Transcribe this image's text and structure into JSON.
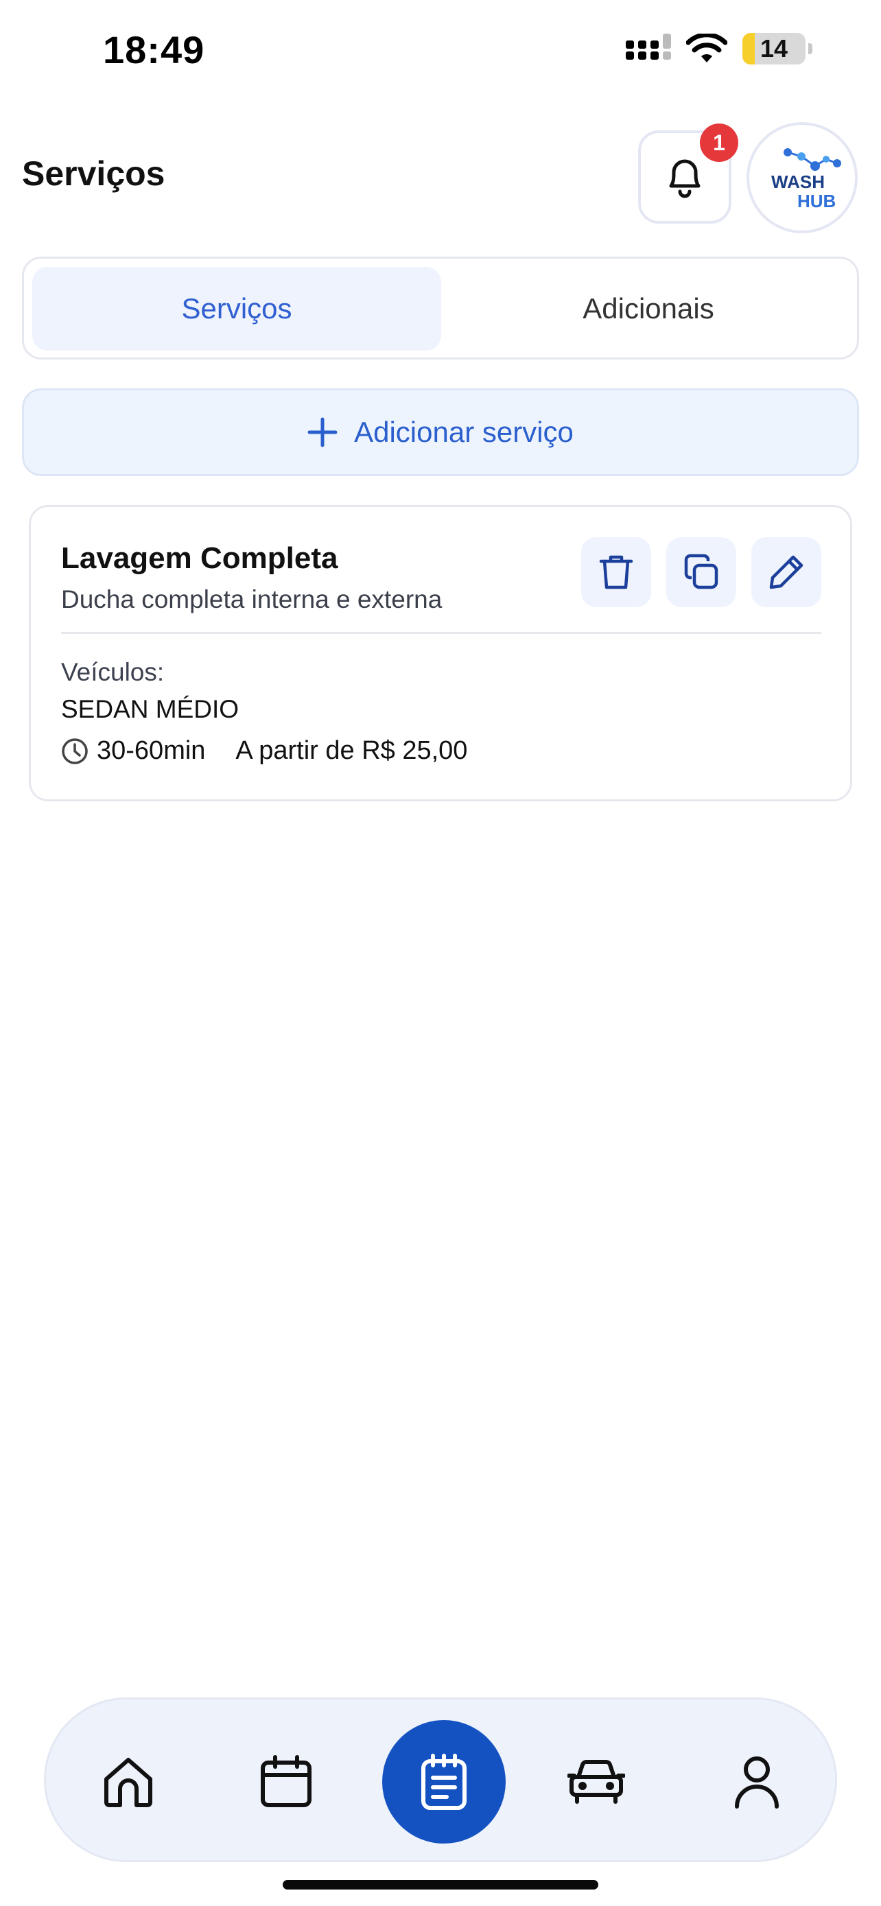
{
  "status_bar": {
    "time": "18:49",
    "battery": "14",
    "icons": [
      "cellular-signal-icon",
      "wifi-icon",
      "battery-icon"
    ]
  },
  "header": {
    "title": "Serviços",
    "notification_count": "1",
    "logo": {
      "line1": "WASH",
      "line2": "HUB"
    }
  },
  "tabs": [
    {
      "label": "Serviços",
      "active": true
    },
    {
      "label": "Adicionais",
      "active": false
    }
  ],
  "add_service": {
    "label": "Adicionar serviço",
    "icon": "plus-icon"
  },
  "services": [
    {
      "title": "Lavagem Completa",
      "description": "Ducha completa interna e externa",
      "vehicles_label": "Veículos:",
      "vehicles": "SEDAN MÉDIO",
      "duration": "30-60min",
      "price": "A partir de R$ 25,00",
      "actions": [
        "trash-icon",
        "copy-icon",
        "edit-icon"
      ]
    }
  ],
  "bottom_nav": {
    "items": [
      "home-icon",
      "calendar-icon",
      "services-icon",
      "car-icon",
      "profile-icon"
    ],
    "active": "services-icon"
  },
  "colors": {
    "accent": "#2f5fd0",
    "primary_dark": "#1452c2",
    "tab_active_bg": "#eef3fd",
    "badge": "#e5383b"
  }
}
